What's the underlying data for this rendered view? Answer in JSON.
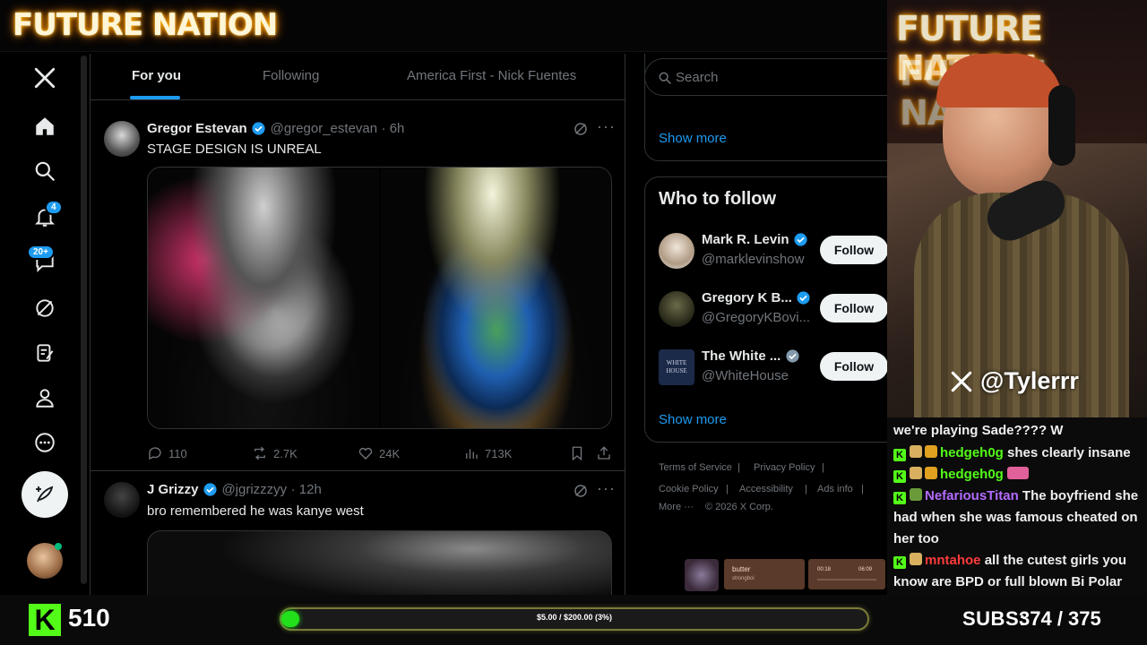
{
  "stream": {
    "brand_title": "FUTURE NATION",
    "webcam_handle": "@Tylerrr",
    "kick_count": "510",
    "goal_text": "$5.00 / $200.00 (3%)",
    "goal_progress_fraction": 0.03,
    "subs_label": "SUBS:",
    "subs_value": "374 / 375",
    "music": {
      "title": "butter",
      "artist": "strongboi",
      "elapsed": "00:18",
      "duration": "06:09"
    }
  },
  "sidebar": {
    "notifications_badge": "4",
    "messages_badge": "20+"
  },
  "timeline": {
    "tabs": [
      {
        "label": "For you",
        "active": true
      },
      {
        "label": "Following",
        "active": false
      },
      {
        "label": "America First - Nick Fuentes",
        "active": false
      }
    ],
    "tweets": [
      {
        "name": "Gregor Estevan",
        "handle": "@gregor_estevan",
        "time": "· 6h",
        "text": "STAGE DESIGN IS UNREAL",
        "replies": "110",
        "reposts": "2.7K",
        "likes": "24K",
        "views": "713K"
      },
      {
        "name": "J Grizzy",
        "handle": "@jgrizzzyy",
        "time": "· 12h",
        "text": "bro remembered he was kanye west"
      }
    ]
  },
  "right": {
    "search_placeholder": "Search",
    "show_more": "Show more",
    "who_to_follow_title": "Who to follow",
    "suggestions": [
      {
        "name": "Mark R. Levin",
        "handle": "@marklevinshow",
        "button": "Follow"
      },
      {
        "name": "Gregory K B...",
        "handle": "@GregoryKBovi...",
        "button": "Follow"
      },
      {
        "name": "The White ...",
        "handle": "@WhiteHouse",
        "button": "Follow"
      }
    ],
    "show_more_2": "Show more",
    "footer": {
      "terms": "Terms of Service",
      "privacy": "Privacy Policy",
      "cookie": "Cookie Policy",
      "accessibility": "Accessibility",
      "ads": "Ads info",
      "more": "More ···",
      "copyright": "© 2026 X Corp."
    }
  },
  "chat": {
    "messages": [
      {
        "user": "",
        "text": "we're playing Sade???? W",
        "color": "#efeff1"
      },
      {
        "user": "hedgeh0g",
        "text": "shes clearly insane",
        "color": "#53fc18"
      },
      {
        "user": "hedgeh0g",
        "text": "",
        "color": "#53fc18"
      },
      {
        "user": "NefariousTitan",
        "text": "The boyfriend she had when she was famous cheated on her too",
        "color": "#b36bff"
      },
      {
        "user": "mntahoe",
        "text": "all the cutest girls you know are BPD or full blown Bi Polar",
        "color": "#ff3b3b"
      }
    ]
  },
  "colors": {
    "accent": "#1d9bf0",
    "kick_green": "#53fc18",
    "background": "#000000"
  }
}
